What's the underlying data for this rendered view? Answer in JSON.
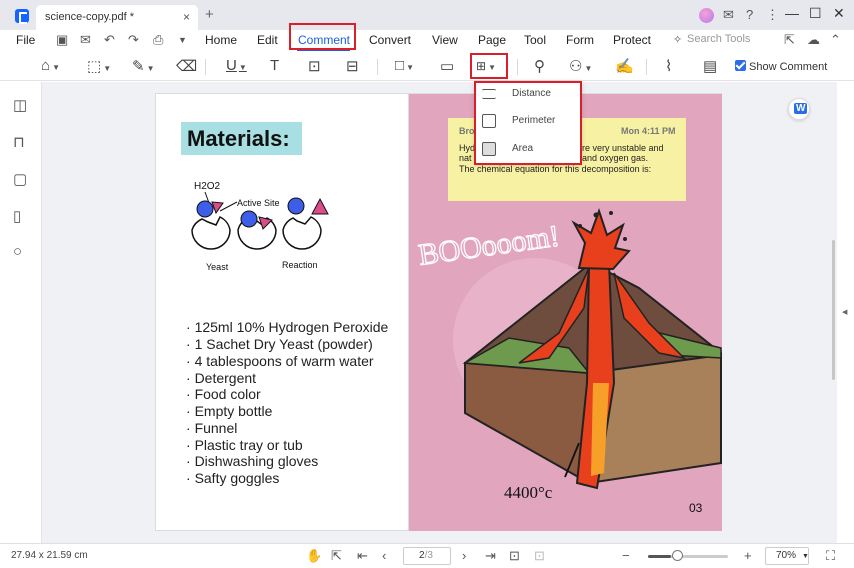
{
  "window": {
    "tab_title": "science-copy.pdf *",
    "close_glyph": "×",
    "add_glyph": "+"
  },
  "titlebar_icons": [
    "avatar",
    "notification-icon",
    "help-icon",
    "more-icon"
  ],
  "window_controls": {
    "minimize": "—",
    "maximize": "☐",
    "close": "✕"
  },
  "menu": {
    "file": "File",
    "items": [
      "Home",
      "Edit",
      "Comment",
      "Convert",
      "View",
      "Page",
      "Tool",
      "Form",
      "Protect"
    ],
    "active": "Comment",
    "search_placeholder": "Search Tools"
  },
  "toolbar": {
    "show_comment_label": "Show Comment",
    "show_comment_checked": true
  },
  "measure_dropdown": {
    "items": [
      {
        "label": "Distance",
        "icon": "distance-icon"
      },
      {
        "label": "Perimeter",
        "icon": "perimeter-icon"
      },
      {
        "label": "Area",
        "icon": "area-icon"
      }
    ]
  },
  "document": {
    "title": "Materials:",
    "diagram_labels": {
      "h2o2": "H2O2",
      "active_site": "Active Site",
      "yeast": "Yeast",
      "reaction": "Reaction"
    },
    "materials": [
      "125ml 10% Hydrogen Peroxide",
      "1 Sachet Dry Yeast (powder)",
      "4 tablespoons of warm water",
      "Detergent",
      "Food color",
      "Empty bottle",
      "Funnel",
      "Plastic tray or tub",
      "Dishwashing gloves",
      "Safty goggles"
    ],
    "boom_text": "BOOooom!",
    "temperature_text": "4400°c",
    "page_number_label": "03"
  },
  "sticky_note": {
    "author": "Bro",
    "time": "Mon 4:11 PM",
    "lines": [
      {
        "left": "Hyd",
        "right": "re very unstable and"
      },
      {
        "left": "nat",
        "right": "and oxygen gas."
      },
      {
        "left": "The chemical equation for this decomposition is:",
        "right": ""
      }
    ]
  },
  "statusbar": {
    "dimensions": "27.94 x 21.59 cm",
    "current_page": "2",
    "total_pages": "/3",
    "zoom": "70%",
    "zoom_level": 0.7
  },
  "colors": {
    "accent": "#1c5fe0",
    "highlight_box": "#d9202a",
    "page_pink": "#e1a6be",
    "title_bg": "#a7dfe2",
    "note_yellow": "#f7f2a3"
  }
}
